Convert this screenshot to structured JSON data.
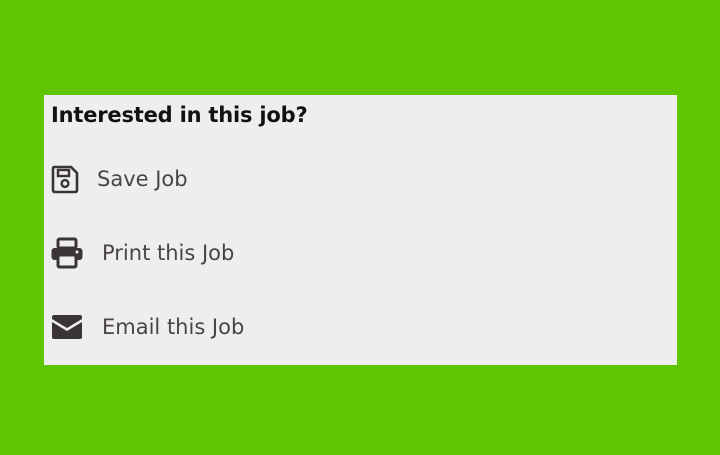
{
  "panel": {
    "heading": "Interested in this job?",
    "actions": [
      {
        "label": "Save Job",
        "icon": "floppy-disk-icon"
      },
      {
        "label": "Print this Job",
        "icon": "printer-icon"
      },
      {
        "label": "Email this Job",
        "icon": "envelope-icon"
      }
    ]
  },
  "colors": {
    "background": "#5fc500",
    "panel": "#eeeeee",
    "heading_text": "#111111",
    "action_text": "#4a4444",
    "icon": "#3b3434"
  }
}
